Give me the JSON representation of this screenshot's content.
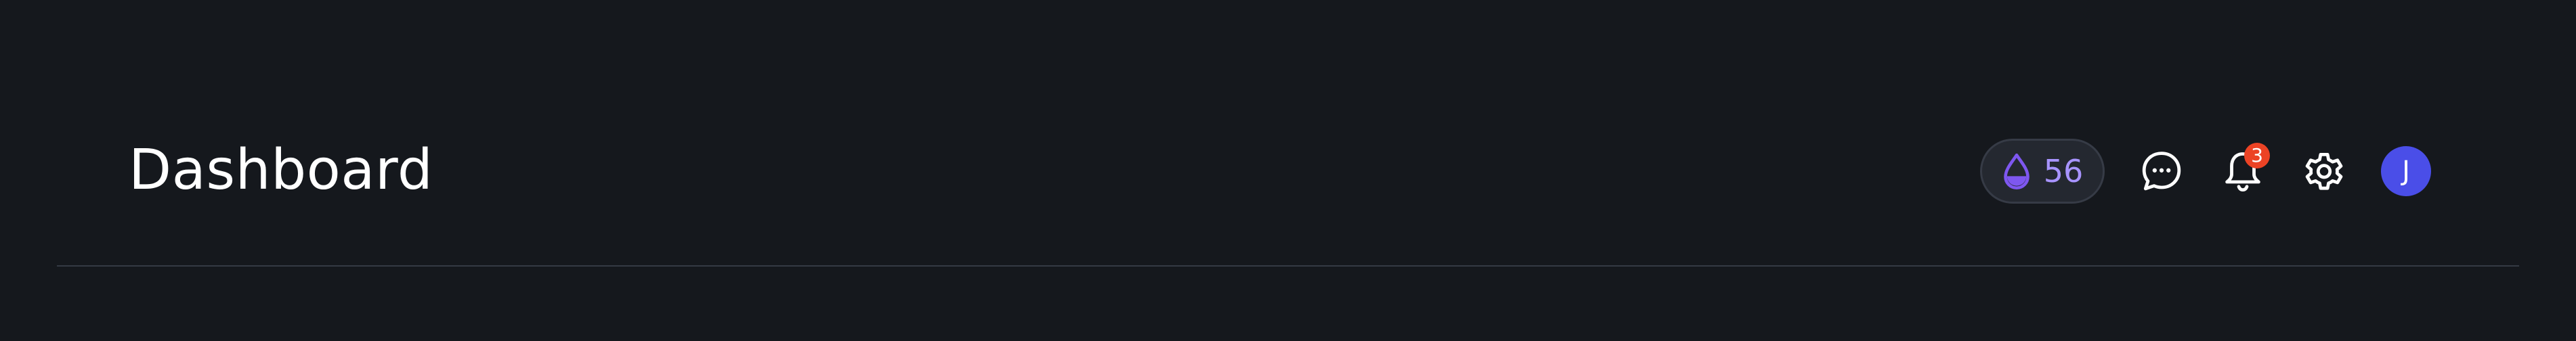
{
  "header": {
    "title": "Dashboard",
    "points": "56",
    "notifications": {
      "count": "3"
    },
    "user": {
      "initial": "J"
    }
  },
  "colors": {
    "background": "#15181d",
    "pill_background": "#242830",
    "pill_border": "#363b46",
    "points_text": "#a894ff",
    "points_icon": "#7e57f0",
    "notification_badge": "#ec4325",
    "avatar": "#4a4ee8",
    "divider": "#353a44"
  },
  "icons": [
    "water-drop-icon",
    "chat-bubble-icon",
    "bell-icon",
    "gear-icon"
  ]
}
